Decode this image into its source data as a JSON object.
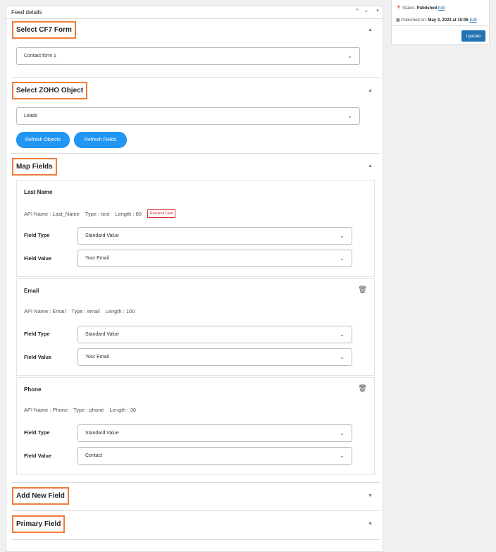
{
  "panel": {
    "title": "Feed details",
    "move_up": "⌃",
    "move_down": "⌄",
    "toggle": "▲"
  },
  "sections": {
    "cf7": {
      "title": "Select CF7 Form",
      "selected": "Contact form 1"
    },
    "zoho": {
      "title": "Select ZOHO Object",
      "selected": "Leads",
      "refresh_objects": "Refresh Objects",
      "refresh_fields": "Refresh Fields"
    },
    "map": {
      "title": "Map Fields"
    },
    "add": {
      "title": "Add New Field"
    },
    "primary": {
      "title": "Primary Field"
    }
  },
  "fields": [
    {
      "name": "Last Name",
      "api": "API Name : Last_Name",
      "type": "Type : text",
      "length": "Length : 80",
      "badge": "Required Field",
      "field_type_label": "Field Type",
      "field_type": "Standard Value",
      "field_value_label": "Field Value",
      "field_value": "Your Email"
    },
    {
      "name": "Email",
      "api": "API Name : Email",
      "type": "Type : email",
      "length": "Length : 100",
      "field_type_label": "Field Type",
      "field_type": "Standard Value",
      "field_value_label": "Field Value",
      "field_value": "Your Email"
    },
    {
      "name": "Phone",
      "api": "API Name : Phone",
      "type": "Type : phone",
      "length": "Length : 30",
      "field_type_label": "Field Type",
      "field_type": "Standard Value",
      "field_value_label": "Field Value",
      "field_value": "Contact"
    }
  ],
  "publish": {
    "status_label": "Status:",
    "status": "Published",
    "edit": "Edit",
    "published_label": "Published on:",
    "published_date": "May 3, 2023 at 10:06",
    "update": "Update"
  },
  "colors": {
    "highlight": "#f07c3a",
    "button": "#2196f3",
    "primary": "#2271b1",
    "required": "#d63638"
  }
}
